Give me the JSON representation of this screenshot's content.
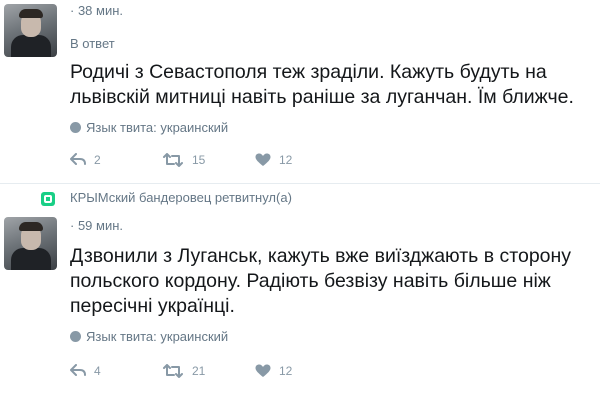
{
  "retweet_context": {
    "label": "КРЫМский бандеровец ретвитнул(а)"
  },
  "tweets": [
    {
      "author_name": "",
      "handle": "",
      "time": "· 38 мин.",
      "reply_prefix": "В ответ",
      "reply_mention": "",
      "text": "Родичі з Севастополя теж зраділи. Кажуть будуть на львівскій митниці навіть раніше за луганчан. Їм ближче.",
      "language": "Язык твита: украинский",
      "replies": "2",
      "retweets": "15",
      "likes": "12"
    },
    {
      "author_name": "",
      "handle": "",
      "time": "· 59 мин.",
      "text": "Дзвонили з Луганськ, кажуть вже виїзджають в сторону польского кордону. Радіють безвізу навіть більше ніж пересічні українці.",
      "language": "Язык твита: украинский",
      "replies": "4",
      "retweets": "21",
      "likes": "12"
    }
  ],
  "colors": {
    "text": "#14171a",
    "secondary": "#657786",
    "mention": "#e0245e",
    "retweet_badge": "#19cf86",
    "divider": "#e6ecf0"
  },
  "icons": {
    "avatar": "author-photo",
    "globe": "globe-icon",
    "reply": "reply-icon",
    "retweet": "retweet-icon",
    "like": "heart-icon",
    "retweet_context": "retweet-badge-icon"
  }
}
